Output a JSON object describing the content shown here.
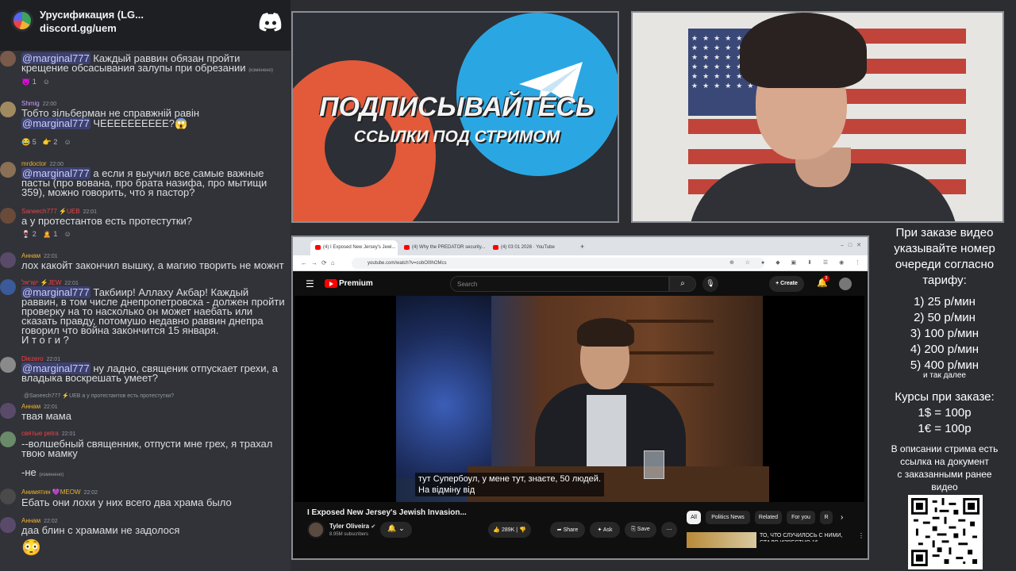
{
  "discord": {
    "server_name": "Урусификация (LG...",
    "invite": "discord.gg/uem",
    "messages": [
      {
        "user": "",
        "time": "",
        "text_mention": "@marginal777",
        "text": " Каждый раввин обязан пройти",
        "text2": "крещение обсасывания залупы при обрезании",
        "edited": "(изменено)",
        "reacts": [
          "😈 1",
          "☺"
        ]
      },
      {
        "user": "Shmig",
        "time": "22:00",
        "text_mention": "",
        "text": "Тобто зільберман не справжній равін",
        "text2": "",
        "edited": "",
        "reacts": []
      },
      {
        "user": "",
        "time": "",
        "text_mention": "@marginal777",
        "text": " ЧЕЕЕЕЕЕЕЕЕЕ?😱",
        "text2": "",
        "edited": "",
        "reacts": [
          "😂 5",
          "👉 2",
          "☺"
        ]
      },
      {
        "user": "mrdoctor",
        "time": "22:00",
        "text_mention": "@marginal777",
        "text": " а если я выучил все самые важные",
        "text2": "пасты (про вована, про брата назифа, про мытищи",
        "text3": "359), можно говорить, что я пастор?",
        "edited": "",
        "reacts": []
      },
      {
        "user": "Saneech777 ⚡UEB",
        "time": "22:01",
        "text_mention": "",
        "text": "а у протестантов есть протестутки?",
        "text2": "",
        "edited": "",
        "reacts": [
          "🍷 2",
          "🙎 1",
          "☺"
        ]
      },
      {
        "user": "Аннам",
        "time": "22:01",
        "text_mention": "",
        "text": "лох какойт закончил вышку, а магию творить не можнт",
        "text2": "",
        "edited": "",
        "reacts": []
      },
      {
        "user": "ישראל ⚡JEW",
        "time": "22:01",
        "text_mention": "@marginal777",
        "text": " Такбиир! Аллаху Акбар! Каждый",
        "text2": "раввин, в том числе днепропетровска - должен пройти",
        "text3": "проверку на то насколько он может наебать или",
        "text4": "сказать правду, потомушо недавно раввин днепра",
        "text5": "говорил что война закончится 15 января.",
        "text6": "И т о г и ?",
        "edited": "",
        "reacts": []
      },
      {
        "user": "Diezero",
        "time": "22:01",
        "text_mention": "@marginal777",
        "text": " ну ладно, священик отпускает грехи, а",
        "text2": "владыка воскрешать умеет?",
        "edited": "",
        "reacts": []
      },
      {
        "reply": "@Saneech777 ⚡UEB а у протестантов есть протестутки?",
        "user": "Аннам",
        "time": "22:01",
        "text_mention": "",
        "text": "твая мама",
        "text2": "",
        "edited": "",
        "reacts": []
      },
      {
        "user": "святые petra",
        "time": "22:01",
        "text_mention": "",
        "text": "--волшебный священник, отпусти мне грех, я трахал",
        "text2": "твою мамку",
        "edited": "",
        "reacts": []
      },
      {
        "user": "",
        "time": "",
        "text_mention": "",
        "text": "-не",
        "text2": "",
        "edited": "(изменено)",
        "reacts": []
      },
      {
        "user": "Анимятин 💜MEOW",
        "time": "22:02",
        "text_mention": "",
        "text": "Ебать они лохи у них всего два храма было",
        "text2": "",
        "edited": "",
        "reacts": []
      },
      {
        "user": "Аннам",
        "time": "22:02",
        "text_mention": "",
        "text": "даа блин с храмами не задолося",
        "text2": "",
        "edited": "",
        "reacts": []
      }
    ],
    "last_emoji": "😳"
  },
  "promo": {
    "title": "ПОДПИСЫВАЙТЕСЬ",
    "subtitle": "ССЫЛКИ ПОД СТРИМОМ"
  },
  "browser": {
    "tabs": [
      {
        "label": "(4) I Exposed New Jersey's Jewi..."
      },
      {
        "label": "(4) Why the PREDATOR security..."
      },
      {
        "label": "(4) 03 01 2026 · YouTube"
      }
    ],
    "url": "youtube.com/watch?v=cobO0lhOMcs",
    "brand": "Premium",
    "search_placeholder": "Search",
    "create_label": "+ Create",
    "bell_badge": "9",
    "subtitle_line1": "тут Супербоул, у мене тут, знаєте, 50 людей.",
    "subtitle_line2": "На відміну від",
    "video_title": "I Exposed New Jersey's Jewish Invasion...",
    "channel_name": "Tyler Oliveira",
    "channel_subs": "8.95M subscribers",
    "like_count": "289K",
    "share_label": "Share",
    "ask_label": "Ask",
    "save_label": "Save",
    "chips": [
      "All",
      "Politics News",
      "Related",
      "For you",
      "R"
    ],
    "rec_title": "ТО, ЧТО СЛУЧИЛОСЬ С НИМИ, СТАЛО ИЗВЕСТНО 16..."
  },
  "info": {
    "intro": [
      "При заказе видео",
      "указывайте номер",
      "очереди согласно",
      "тарифу:"
    ],
    "prices": [
      "1) 25 р/мин",
      "2) 50 р/мин",
      "3) 100 р/мин",
      "4) 200 р/мин",
      "5) 400 р/мин"
    ],
    "etc": "и так далее",
    "courses": [
      "Курсы при заказе:",
      "1$ = 100р",
      "1€ = 100р"
    ],
    "desc": [
      "В описании стрима есть",
      "ссылка на документ",
      "с заказанными ранее",
      "видео"
    ]
  },
  "colors": {
    "discord_bg": "#313338",
    "mention": "#c9cdfb",
    "yt_red": "#ff0000",
    "promo_red": "#e25a3a",
    "promo_blue": "#2aa7e3"
  }
}
